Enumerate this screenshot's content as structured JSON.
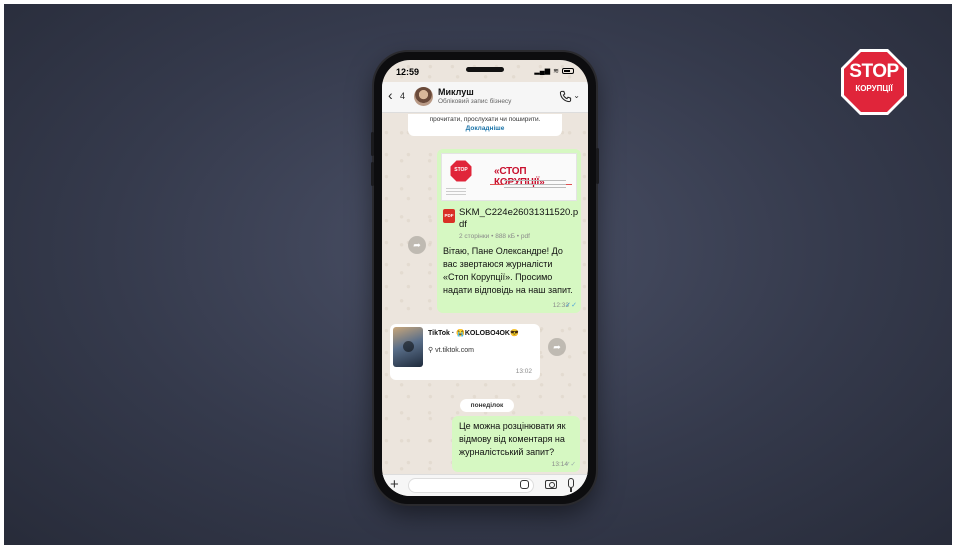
{
  "badge": {
    "stop": "STOP",
    "sub": "КОРУПЦІЇ",
    "color": "#e0253a"
  },
  "status_bar": {
    "time": "12:59"
  },
  "chat_header": {
    "back_count": "4",
    "contact_name": "Миклуш",
    "contact_subtitle": "Обліковий запис бізнесу"
  },
  "messages": {
    "top_card": {
      "text": "прочитати, прослухати чи поширити.",
      "link": "Докладніше"
    },
    "pdf": {
      "preview_title": "«СТОП КОРУПЦІЇ»",
      "preview_logo": "STOP",
      "file_name": "SKM_C224e26031311520.pdf",
      "meta": "2 сторінки • 888 кБ • pdf",
      "icon_label": "PDF",
      "text": "Вітаю, Пане Олександре! До вас звертаюся журналісти «Стоп Корупції». Просимо надати відповідь на наш запит.",
      "time": "12:33"
    },
    "tiktok": {
      "title": "TikTok · 😭KOLOBO4OK😎",
      "link": "vt.tiktok.com",
      "time": "13:02"
    },
    "day_separator": "понеділок",
    "last": {
      "text": "Це можна розцінювати як відмову від коментаря на журналістський запит?",
      "time": "13:14"
    }
  }
}
